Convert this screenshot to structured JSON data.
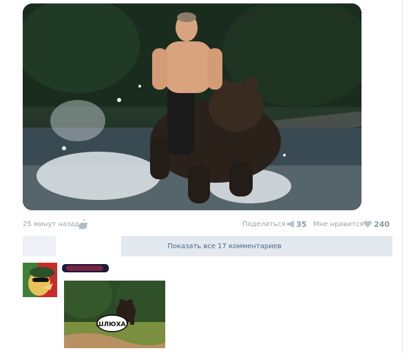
{
  "post": {
    "photo_alt": "shirtless man riding a bear through water",
    "time": "25 минут назад",
    "share_label": "Поделиться",
    "share_count": "35",
    "like_label": "Мне нравится",
    "like_count": "240"
  },
  "comments": {
    "show_all_label": "Показать все 17 комментариев"
  },
  "comment": {
    "attachment_speech_text": "ШЛЮХА!"
  },
  "colors": {
    "link": "#45688e",
    "muted": "#9aa4ad",
    "bar_bg": "#e4e9ef"
  }
}
